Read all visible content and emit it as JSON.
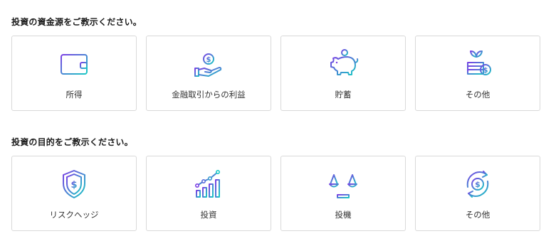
{
  "sections": [
    {
      "title": "投資の資金源をご教示ください。",
      "options": [
        {
          "label": "所得",
          "icon": "wallet-icon"
        },
        {
          "label": "金融取引からの利益",
          "icon": "coin-hand-icon"
        },
        {
          "label": "貯蓄",
          "icon": "piggy-bank-icon"
        },
        {
          "label": "その他",
          "icon": "plant-coins-icon"
        }
      ]
    },
    {
      "title": "投資の目的をご教示ください。",
      "options": [
        {
          "label": "リスクヘッジ",
          "icon": "shield-dollar-icon"
        },
        {
          "label": "投資",
          "icon": "growth-chart-icon"
        },
        {
          "label": "投機",
          "icon": "scale-icon"
        },
        {
          "label": "その他",
          "icon": "cycle-dollar-icon"
        }
      ]
    }
  ],
  "colors": {
    "gradient_start": "#7b3fe4",
    "gradient_end": "#19c9c4",
    "border": "#d9d9d9"
  }
}
